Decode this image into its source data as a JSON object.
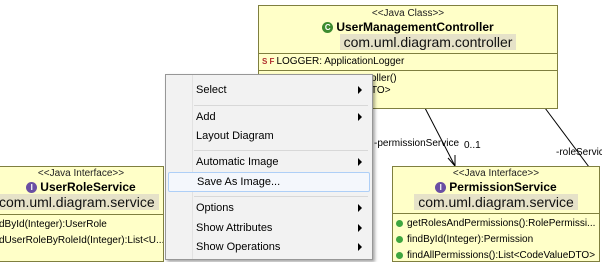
{
  "controller_box": {
    "stereotype": "<<Java Class>>",
    "name": "UserManagementController",
    "package": "com.uml.diagram.controller",
    "field": "LOGGER: ApplicationLogger",
    "method_fragment_1": "oller()",
    "method_fragment_2": "TO>"
  },
  "role_service_box": {
    "stereotype": "<<Java Interface>>",
    "name": "UserRoleService",
    "package": "com.uml.diagram.service",
    "method_1": "dById(Integer):UserRole",
    "method_2": "dUserRoleByRoleId(Integer):List<U..."
  },
  "permission_box": {
    "stereotype": "<<Java Interface>>",
    "name": "PermissionService",
    "package": "com.uml.diagram.service",
    "method_1": "getRolesAndPermissions():RolePermissi...",
    "method_2": "findById(Integer):Permission",
    "method_3": "findAllPermissions():List<CodeValueDTO>"
  },
  "edges": {
    "permission_label": "-permissionService",
    "permission_mult": "0..1",
    "role_label": "-roleServic"
  },
  "context_menu": {
    "items": [
      {
        "label": "Select",
        "submenu": true
      },
      {
        "label": "Add",
        "submenu": true
      },
      {
        "label": "Layout Diagram",
        "submenu": false
      },
      {
        "label": "Automatic Image",
        "submenu": true
      },
      {
        "label": "Save As Image...",
        "submenu": false,
        "highlighted": true
      },
      {
        "label": "Options",
        "submenu": true
      },
      {
        "label": "Show Attributes",
        "submenu": true
      },
      {
        "label": "Show Operations",
        "submenu": true
      }
    ]
  }
}
